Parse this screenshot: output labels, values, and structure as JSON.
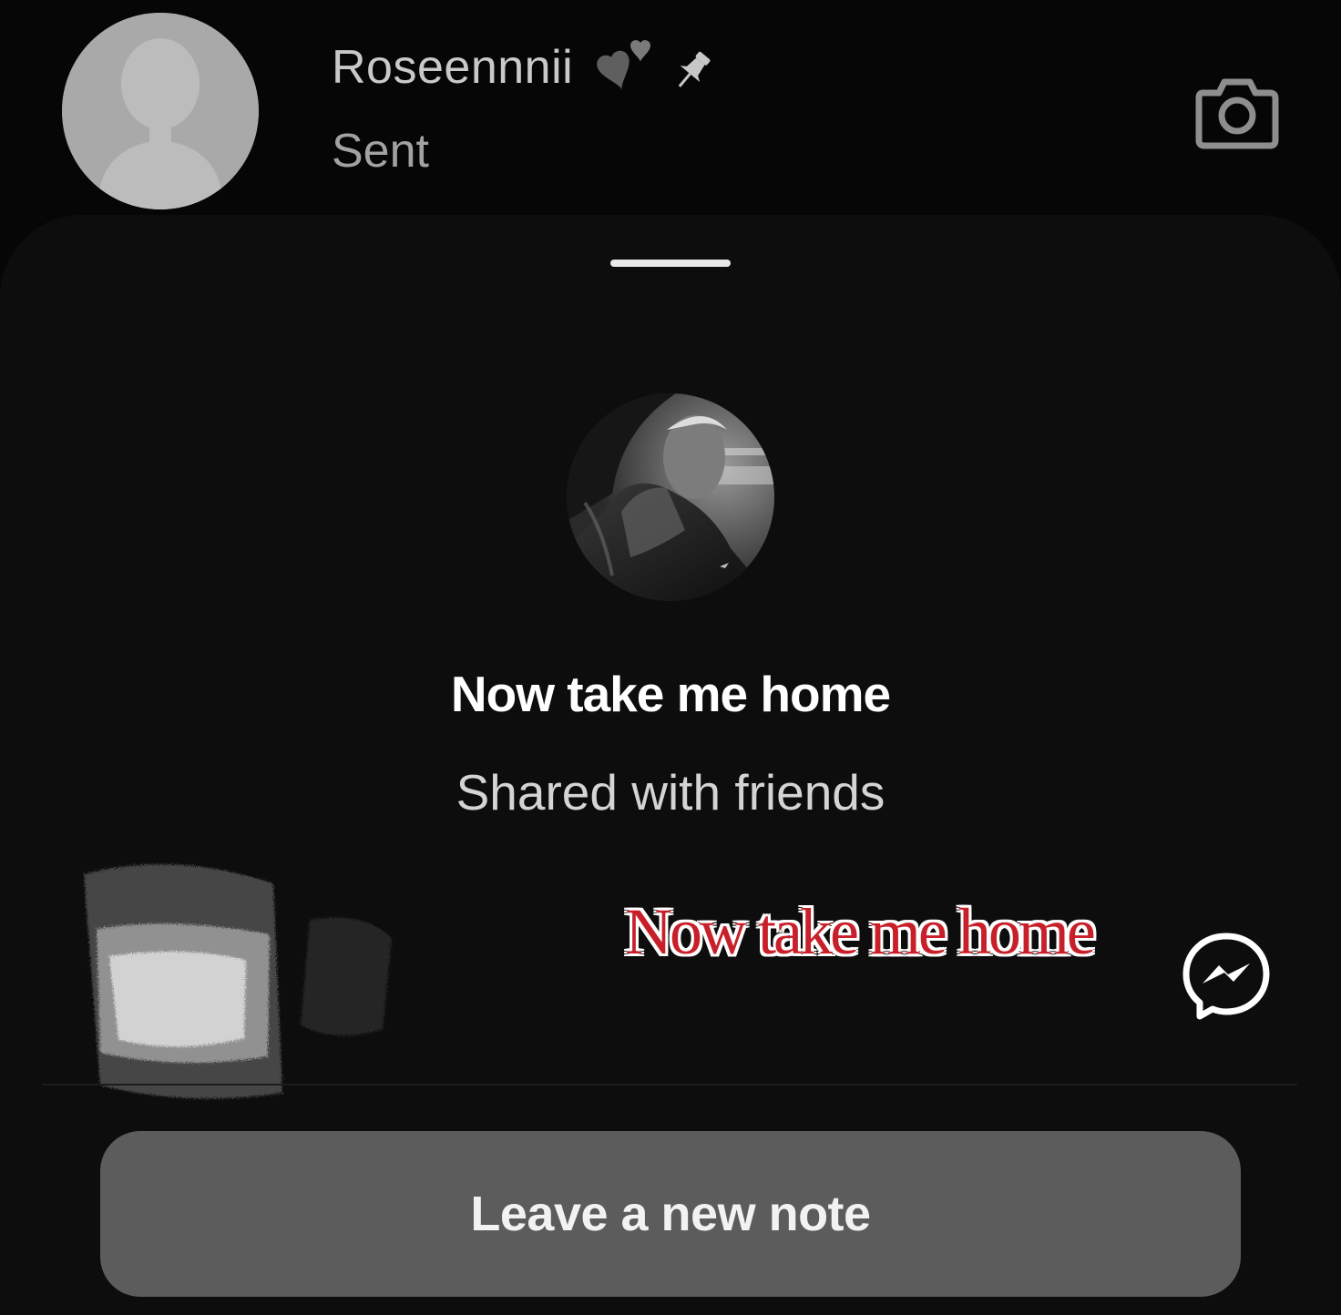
{
  "chat": {
    "name": "Roseennnii",
    "status": "Sent",
    "icons": {
      "avatar": "default-avatar-silhouette",
      "hearts": "black-hearts-emoji",
      "pin": "pin-icon",
      "camera": "camera-icon"
    }
  },
  "note_sheet": {
    "note_text": "Now take me home",
    "audience": "Shared with friends",
    "overlay_caption": "Now take me home",
    "leave_button_label": "Leave a new note",
    "icons": {
      "grabber": "sheet-grabber",
      "profile": "profile-photo",
      "messenger": "messenger-icon",
      "scribble": "scribble-sticker"
    }
  },
  "colors": {
    "background": "#060606",
    "sheet": "#0d0d0d",
    "button": "#5c5c5c",
    "caption_red": "#c8202a"
  }
}
